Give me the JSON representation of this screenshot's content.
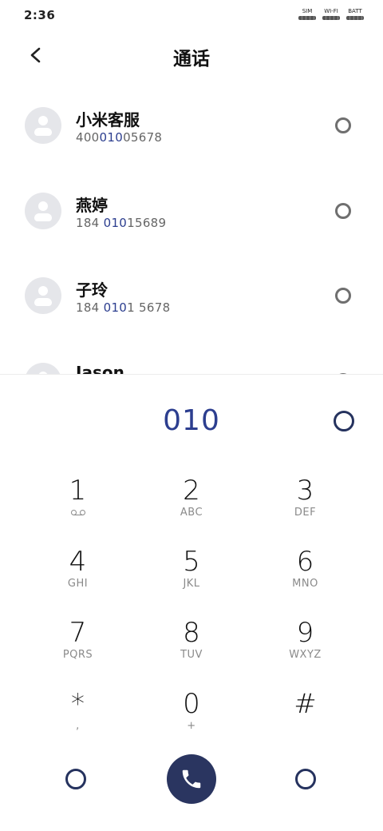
{
  "status_bar": {
    "time": "2:36",
    "indicators": [
      {
        "label": "SIM"
      },
      {
        "label": "WI-FI"
      },
      {
        "label": "BATT"
      }
    ]
  },
  "header": {
    "title": "通话",
    "back_icon": "chevron-left-icon"
  },
  "contacts": [
    {
      "name": "小米客服",
      "number_parts": [
        "400",
        "010",
        "05678"
      ],
      "action_icon": "ring-icon"
    },
    {
      "name": "燕婷",
      "number_parts": [
        "184 ",
        "010",
        "15689"
      ],
      "action_icon": "ring-icon"
    },
    {
      "name": "子玲",
      "number_parts": [
        "184 ",
        "010",
        "1 5678"
      ],
      "action_icon": "ring-icon"
    },
    {
      "name": "Jason",
      "number_parts": [
        "",
        "",
        ""
      ],
      "action_icon": "ring-icon"
    }
  ],
  "dialer": {
    "input": "010",
    "delete_icon": "backspace-icon"
  },
  "keypad": [
    {
      "digit": "1",
      "letters": ""
    },
    {
      "digit": "2",
      "letters": "ABC"
    },
    {
      "digit": "3",
      "letters": "DEF"
    },
    {
      "digit": "4",
      "letters": "GHI"
    },
    {
      "digit": "5",
      "letters": "JKL"
    },
    {
      "digit": "6",
      "letters": "MNO"
    },
    {
      "digit": "7",
      "letters": "PQRS"
    },
    {
      "digit": "8",
      "letters": "TUV"
    },
    {
      "digit": "9",
      "letters": "WXYZ"
    },
    {
      "digit": "*",
      "letters": ","
    },
    {
      "digit": "0",
      "letters": "+"
    },
    {
      "digit": "#",
      "letters": ""
    }
  ],
  "bottom_bar": {
    "left_icon": "collapse-keypad-icon",
    "call_icon": "phone-icon",
    "right_icon": "menu-icon"
  },
  "colors": {
    "accent": "#2c3e8f",
    "call_button": "#2a3560",
    "avatar_bg": "#e5e6ea"
  }
}
